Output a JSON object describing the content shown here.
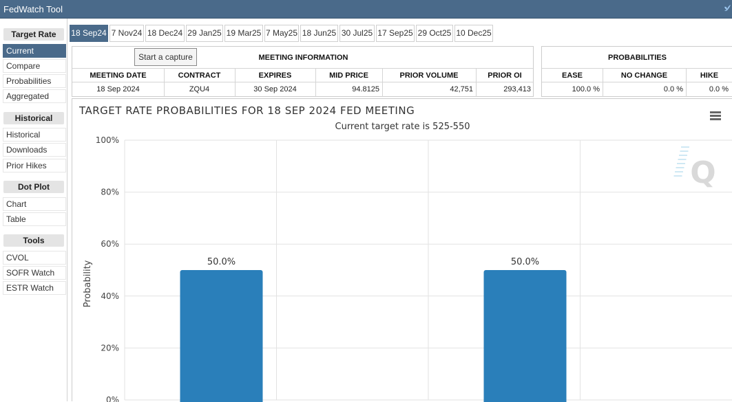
{
  "app": {
    "title": "FedWatch Tool",
    "twitter_icon": "twitter-bird-icon"
  },
  "sidebar": {
    "sections": [
      {
        "header": "Target Rate",
        "items": [
          "Current",
          "Compare",
          "Probabilities",
          "Aggregated"
        ],
        "active": "Current"
      },
      {
        "header": "Historical",
        "items": [
          "Historical",
          "Downloads",
          "Prior Hikes"
        ]
      },
      {
        "header": "Dot Plot",
        "items": [
          "Chart",
          "Table"
        ]
      },
      {
        "header": "Tools",
        "items": [
          "CVOL",
          "SOFR Watch",
          "ESTR Watch"
        ]
      }
    ]
  },
  "tabs": [
    "18 Sep24",
    "7 Nov24",
    "18 Dec24",
    "29 Jan25",
    "19 Mar25",
    "7 May25",
    "18 Jun25",
    "30 Jul25",
    "17 Sep25",
    "29 Oct25",
    "10 Dec25"
  ],
  "active_tab": "18 Sep24",
  "capture_button": "Start a capture",
  "meeting_info": {
    "title": "MEETING INFORMATION",
    "headers": [
      "MEETING DATE",
      "CONTRACT",
      "EXPIRES",
      "MID PRICE",
      "PRIOR VOLUME",
      "PRIOR OI"
    ],
    "row": [
      "18 Sep 2024",
      "ZQU4",
      "30 Sep 2024",
      "94.8125",
      "42,751",
      "293,413"
    ]
  },
  "probabilities": {
    "title": "PROBABILITIES",
    "headers": [
      "EASE",
      "NO CHANGE",
      "HIKE"
    ],
    "row": [
      "100.0 %",
      "0.0 %",
      "0.0 %"
    ]
  },
  "chart": {
    "menu_icon": "hamburger-menu-icon",
    "watermark_icon": "q-logo-icon",
    "accent_color": "#2a7fba"
  },
  "chart_data": {
    "type": "bar",
    "title": "TARGET RATE PROBABILITIES FOR 18 SEP 2024 FED MEETING",
    "subtitle": "Current target rate is 525-550",
    "xlabel": "",
    "ylabel": "Probability",
    "ylim": [
      0,
      100
    ],
    "yticks": [
      "0%",
      "20%",
      "40%",
      "60%",
      "80%",
      "100%"
    ],
    "categories": [
      "",
      ""
    ],
    "values": [
      50.0,
      50.0
    ],
    "data_labels": [
      "50.0%",
      "50.0%"
    ],
    "grid": true,
    "color": "#2a7fba"
  }
}
